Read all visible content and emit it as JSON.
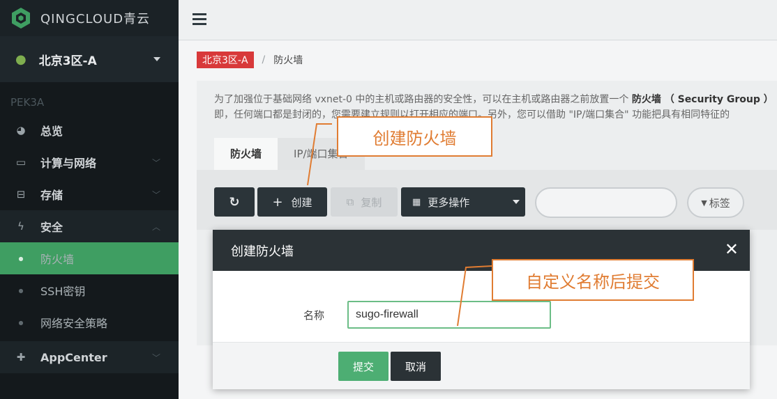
{
  "brand": {
    "name": "QINGCLOUD青云"
  },
  "zone": {
    "label": "北京3区-A"
  },
  "region": {
    "code": "PEK3A"
  },
  "sidebar": {
    "items": [
      {
        "label": "总览",
        "icon": "dashboard-icon"
      },
      {
        "label": "计算与网络",
        "icon": "laptop-icon"
      },
      {
        "label": "存储",
        "icon": "drive-icon"
      },
      {
        "label": "安全",
        "icon": "bolt-icon"
      },
      {
        "label": "防火墙"
      },
      {
        "label": "SSH密钥"
      },
      {
        "label": "网络安全策略"
      },
      {
        "label": "AppCenter",
        "icon": "puzzle-icon"
      }
    ]
  },
  "breadcrumb": {
    "zone": "北京3区-A",
    "separator": "/",
    "current": "防火墙"
  },
  "description": {
    "line1_pre": "为了加强位于基础网络 vxnet-0 中的主机或路由器的安全性，可以在主机或路由器之前放置一个 ",
    "line1_bold": "防火墙 （ Security Group ）",
    "line2": "即，任何端口都是封闭的，您需要建立规则以打开相应的端口。另外，您可以借助 \"IP/端口集合\" 功能把具有相同特征的"
  },
  "tabs": [
    {
      "label": "防火墙"
    },
    {
      "label": "IP/端口集合"
    }
  ],
  "toolbar": {
    "create_label": "创建",
    "copy_label": "复制",
    "more_label": "更多操作",
    "tag_label": "标签"
  },
  "modal": {
    "title": "创建防火墙",
    "name_label": "名称",
    "name_value": "sugo-firewall",
    "submit_label": "提交",
    "cancel_label": "取消"
  },
  "callouts": {
    "create": "创建防火墙",
    "submit": "自定义名称后提交"
  },
  "colors": {
    "accent_green": "#3f9e62",
    "badge_red": "#d8393a",
    "callout_orange": "#e07c32",
    "dark": "#2b3236"
  }
}
